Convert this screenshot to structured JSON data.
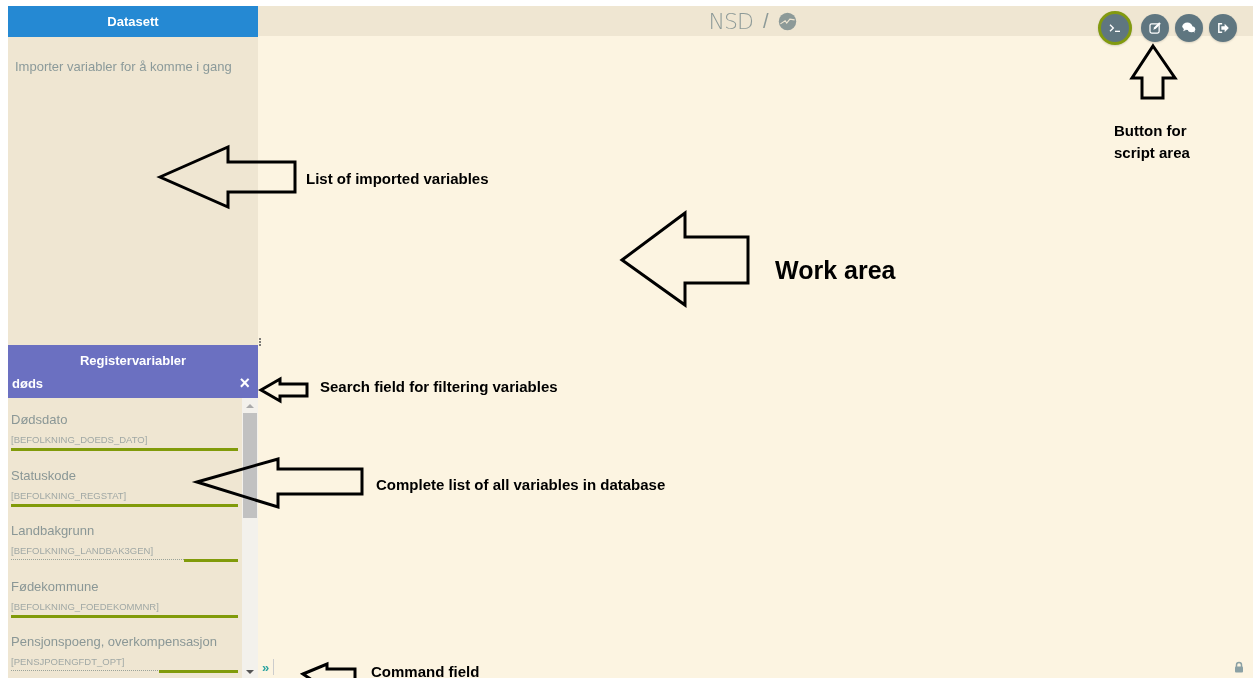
{
  "top_bar": {
    "logo": "NSD",
    "separator": "/",
    "buttons": [
      {
        "kind": "terminal",
        "selected": true
      },
      {
        "kind": "edit",
        "selected": false
      },
      {
        "kind": "chat",
        "selected": false
      },
      {
        "kind": "logout",
        "selected": false
      }
    ]
  },
  "dataset_panel": {
    "title": "Datasett",
    "empty_message": "Importer variabler for å komme i gang"
  },
  "register_panel": {
    "title": "Registervariabler",
    "search": {
      "value": "døds",
      "clear": "×"
    },
    "variables": [
      {
        "label": "Dødsdato",
        "code": "[BEFOLKNING_DOEDS_DATO]",
        "level": 1
      },
      {
        "label": "Statuskode",
        "code": "[BEFOLKNING_REGSTAT]",
        "level": 1
      },
      {
        "label": "Landbakgrunn",
        "code": "[BEFOLKNING_LANDBAK3GEN]",
        "level": 0.24
      },
      {
        "label": "Fødekommune",
        "code": "[BEFOLKNING_FOEDEKOMMNR]",
        "level": 1
      },
      {
        "label": "Pensjonspoeng, overkompensasjon",
        "code": "[PENSJPOENGFDT_OPT]",
        "level": 0.35
      }
    ]
  },
  "command_line": {
    "prompt": "»"
  },
  "annotations": [
    {
      "text": "List of imported variables"
    },
    {
      "text": "Work area"
    },
    {
      "text": "Button for script area"
    },
    {
      "text": "Search field for filtering variables"
    },
    {
      "text": "Complete list of all variables in database"
    },
    {
      "text": "Command field"
    }
  ]
}
